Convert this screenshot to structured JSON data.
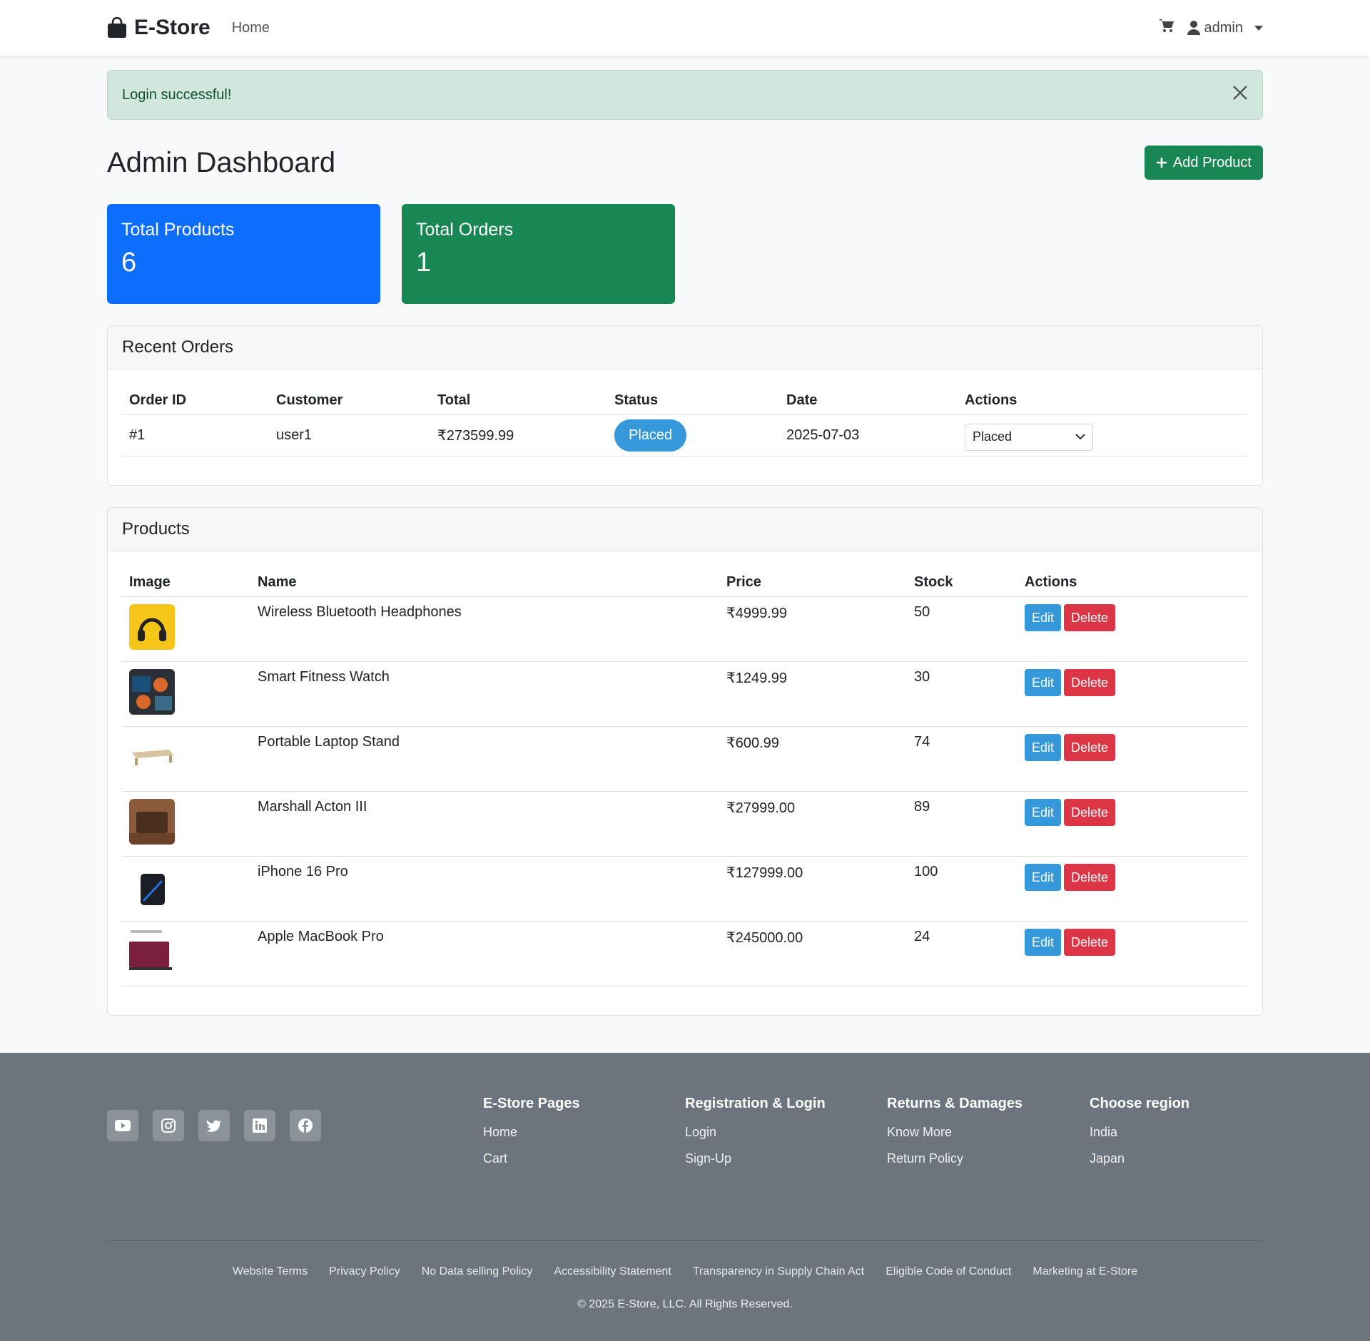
{
  "nav": {
    "brand": "E-Store",
    "home": "Home",
    "user": "admin"
  },
  "alert": {
    "message": "Login successful!"
  },
  "dashboard": {
    "title": "Admin Dashboard",
    "add_label": "Add Product"
  },
  "stats": [
    {
      "label": "Total Products",
      "value": "6",
      "color": "#0d6efd"
    },
    {
      "label": "Total Orders",
      "value": "1",
      "color": "#198754"
    }
  ],
  "orders": {
    "title": "Recent Orders",
    "columns": [
      "Order ID",
      "Customer",
      "Total",
      "Status",
      "Date",
      "Actions"
    ],
    "rows": [
      {
        "id": "#1",
        "customer": "user1",
        "total": "₹273599.99",
        "status": "Placed",
        "date": "2025-07-03",
        "select": "Placed"
      }
    ]
  },
  "products": {
    "title": "Products",
    "columns": [
      "Image",
      "Name",
      "Price",
      "Stock",
      "Actions"
    ],
    "edit_label": "Edit",
    "delete_label": "Delete",
    "rows": [
      {
        "name": "Wireless Bluetooth Headphones",
        "price": "₹4999.99",
        "stock": "50"
      },
      {
        "name": "Smart Fitness Watch",
        "price": "₹1249.99",
        "stock": "30"
      },
      {
        "name": "Portable Laptop Stand",
        "price": "₹600.99",
        "stock": "74"
      },
      {
        "name": "Marshall Acton III",
        "price": "₹27999.00",
        "stock": "89"
      },
      {
        "name": "iPhone 16 Pro",
        "price": "₹127999.00",
        "stock": "100"
      },
      {
        "name": "Apple MacBook Pro",
        "price": "₹245000.00",
        "stock": "24"
      }
    ]
  },
  "footer": {
    "socials": [
      "youtube-icon",
      "instagram-icon",
      "twitter-icon",
      "linkedin-icon",
      "facebook-icon"
    ],
    "columns": [
      {
        "title": "E-Store Pages",
        "links": [
          "Home",
          "Cart"
        ]
      },
      {
        "title": "Registration & Login",
        "links": [
          "Login",
          "Sign-Up"
        ]
      },
      {
        "title": "Returns & Damages",
        "links": [
          "Know More",
          "Return Policy"
        ]
      },
      {
        "title": "Choose region",
        "links": [
          "India",
          "Japan"
        ]
      }
    ],
    "legal": [
      "Website Terms",
      "Privacy Policy",
      "No Data selling Policy",
      "Accessibility Statement",
      "Transparency in Supply Chain Act",
      "Eligible Code of Conduct",
      "Marketing at E-Store"
    ],
    "copyright": "© 2025 E-Store, LLC. All Rights Reserved."
  }
}
